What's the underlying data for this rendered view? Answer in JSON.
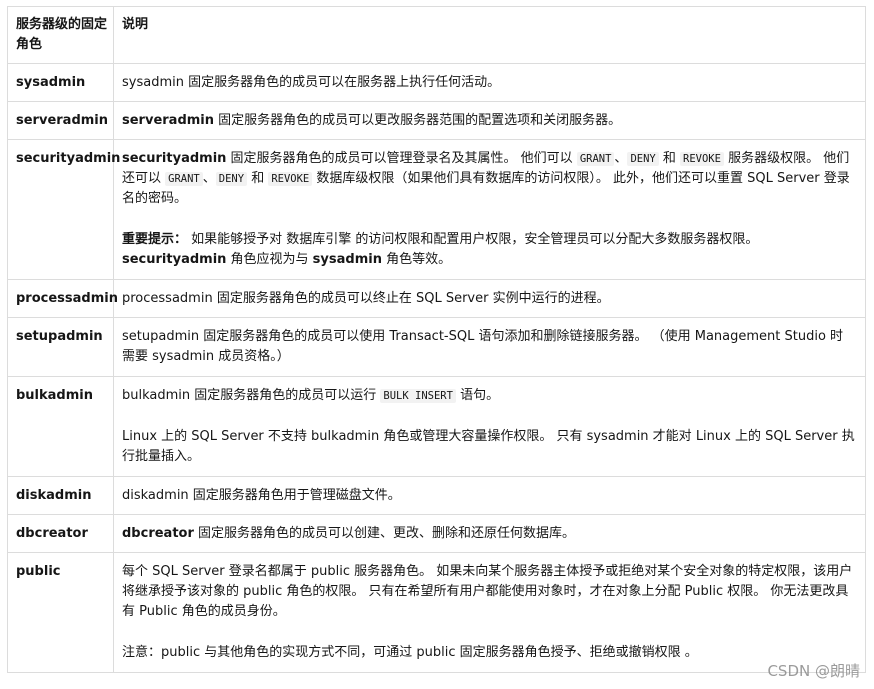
{
  "header": {
    "col1": "服务器级的固定角色",
    "col2": "说明"
  },
  "rows": [
    {
      "role": "sysadmin",
      "desc": [
        "sysadmin 固定服务器角色的成员可以在服务器上执行任何活动。"
      ]
    },
    {
      "role": "serveradmin",
      "desc": [
        "serveradmin",
        " 固定服务器角色的成员可以更改服务器范围的配置选项和关闭服务器。"
      ]
    },
    {
      "role": "securityadmin",
      "p1": [
        "securityadmin",
        " 固定服务器角色的成员可以管理登录名及其属性。 他们可以 ",
        "GRANT",
        "、",
        "DENY",
        " 和 ",
        "REVOKE",
        " 服务器级权限。 他们还可以 ",
        "GRANT",
        "、",
        "DENY",
        " 和 ",
        "REVOKE",
        " 数据库级权限（如果他们具有数据库的访问权限）。 此外，他们还可以重置 SQL Server 登录名的密码。"
      ],
      "p2": [
        "重要提示：",
        " 如果能够授予对 数据库引擎 的访问权限和配置用户权限，安全管理员可以分配大多数服务器权限。 ",
        "securityadmin",
        " 角色应视为与 ",
        "sysadmin",
        " 角色等效。"
      ]
    },
    {
      "role": "processadmin",
      "desc": [
        "processadmin 固定服务器角色的成员可以终止在 SQL Server 实例中运行的进程。"
      ]
    },
    {
      "role": "setupadmin",
      "desc": [
        "setupadmin 固定服务器角色的成员可以使用 Transact-SQL 语句添加和删除链接服务器。 （使用 Management Studio 时需要 sysadmin 成员资格。）"
      ]
    },
    {
      "role": "bulkadmin",
      "p1": [
        "bulkadmin 固定服务器角色的成员可以运行 ",
        "BULK INSERT",
        " 语句。"
      ],
      "p2": [
        "Linux 上的 SQL Server 不支持 bulkadmin 角色或管理大容量操作权限。 只有 sysadmin 才能对 Linux 上的 SQL Server 执行批量插入。"
      ]
    },
    {
      "role": "diskadmin",
      "desc": [
        "diskadmin 固定服务器角色用于管理磁盘文件。"
      ]
    },
    {
      "role": "dbcreator",
      "desc": [
        "dbcreator",
        " 固定服务器角色的成员可以创建、更改、删除和还原任何数据库。"
      ]
    },
    {
      "role": "public",
      "p1": [
        "每个 SQL Server 登录名都属于 public 服务器角色。 如果未向某个服务器主体授予或拒绝对某个安全对象的特定权限，该用户将继承授予该对象的 public 角色的权限。 只有在希望所有用户都能使用对象时，才在对象上分配 Public 权限。 你无法更改具有 Public 角色的成员身份。"
      ],
      "p2": [
        "注意：public 与其他角色的实现方式不同，可通过 public 固定服务器角色授予、拒绝或撤销权限 。"
      ]
    }
  ],
  "watermark": "CSDN @朗晴"
}
